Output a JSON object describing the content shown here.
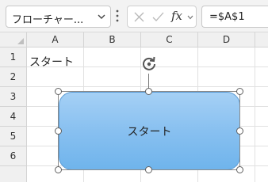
{
  "formula_bar": {
    "name_box": "フローチャー...",
    "formula_value": "=$A$1",
    "fx_label": "fx"
  },
  "columns": [
    "A",
    "B",
    "C",
    "D"
  ],
  "rows": [
    "1",
    "2",
    "3",
    "4",
    "5",
    "6"
  ],
  "cells": {
    "A1": "スタート"
  },
  "shape": {
    "text": "スタート",
    "fill_top": "#a5d0f5",
    "fill_bottom": "#6fb4ec",
    "border": "#5a9bd5"
  },
  "icons": {
    "name_box_dropdown": "chevron-down-icon",
    "options": "more-vertical-icon",
    "cancel": "close-icon",
    "enter": "check-icon",
    "insert_function": "fx-icon",
    "rotate": "rotate-icon"
  }
}
